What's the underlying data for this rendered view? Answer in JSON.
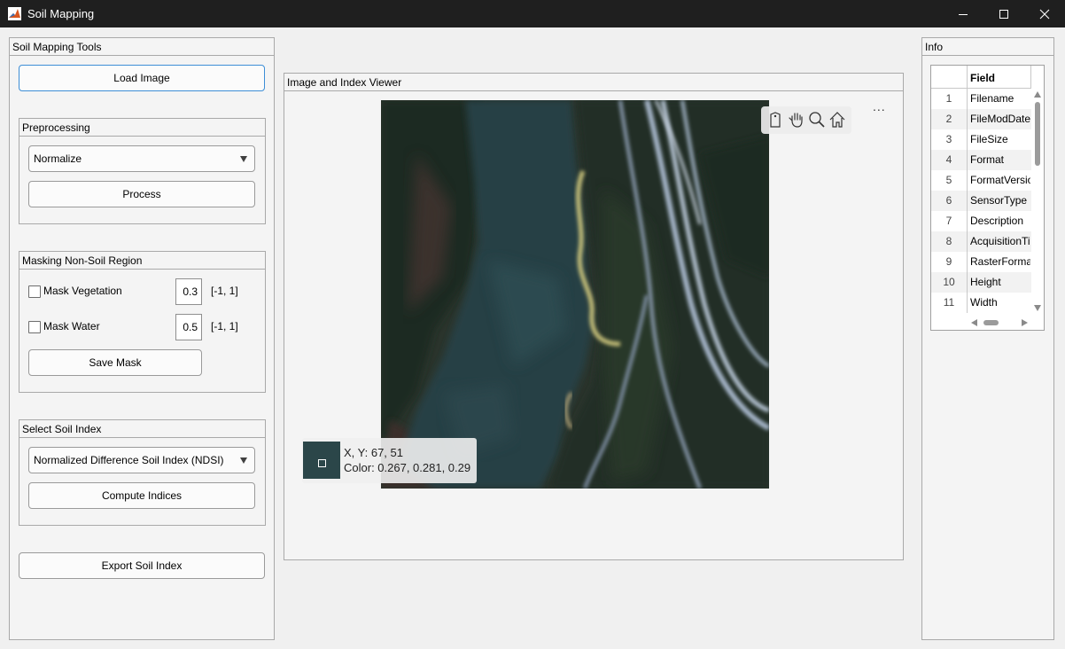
{
  "window": {
    "title": "Soil Mapping"
  },
  "tools_panel": {
    "title": "Soil Mapping Tools",
    "load_image_label": "Load Image",
    "preprocessing": {
      "title": "Preprocessing",
      "method_selected": "Normalize",
      "process_label": "Process"
    },
    "masking": {
      "title": "Masking Non-Soil Region",
      "vegetation": {
        "label": "Mask Vegetation",
        "threshold": "0.3",
        "range": "[-1, 1]",
        "checked": false
      },
      "water": {
        "label": "Mask Water",
        "threshold": "0.5",
        "range": "[-1, 1]",
        "checked": false
      },
      "save_mask_label": "Save Mask"
    },
    "soil_index": {
      "title": "Select Soil Index",
      "index_selected": "Normalized Difference Soil Index (NDSI)",
      "compute_label": "Compute Indices"
    },
    "export_label": "Export Soil Index"
  },
  "viewer": {
    "title": "Image and Index Viewer",
    "more_label": "...",
    "datatip": {
      "xy": "X, Y: 67, 51",
      "color": "Color: 0.267, 0.281, 0.29",
      "swatch_color": "#2b4649"
    },
    "toolbar_icons": [
      "tag-icon",
      "pan-hand-icon",
      "zoom-icon",
      "home-icon"
    ]
  },
  "info_panel": {
    "title": "Info",
    "table": {
      "header_field": "Field",
      "rows": [
        {
          "num": "1",
          "field": "Filename"
        },
        {
          "num": "2",
          "field": "FileModDate"
        },
        {
          "num": "3",
          "field": "FileSize"
        },
        {
          "num": "4",
          "field": "Format"
        },
        {
          "num": "5",
          "field": "FormatVersion"
        },
        {
          "num": "6",
          "field": "SensorType"
        },
        {
          "num": "7",
          "field": "Description"
        },
        {
          "num": "8",
          "field": "AcquisitionTime"
        },
        {
          "num": "9",
          "field": "RasterFormat"
        },
        {
          "num": "10",
          "field": "Height"
        },
        {
          "num": "11",
          "field": "Width"
        }
      ]
    }
  }
}
